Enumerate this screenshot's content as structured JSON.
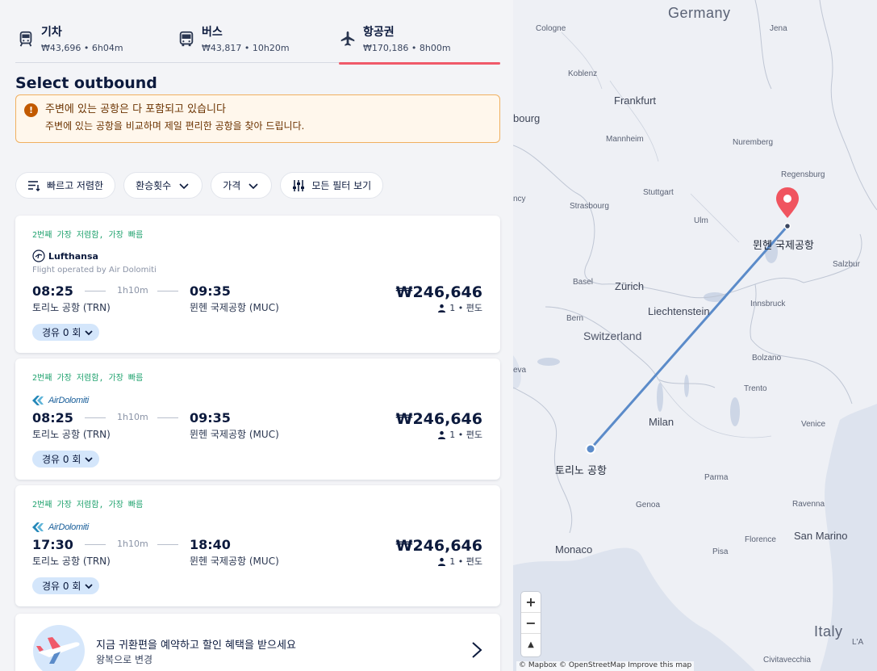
{
  "modes": [
    {
      "label": "기차",
      "summary": "₩43,696 • 6h04m",
      "icon": "train-icon",
      "active": false
    },
    {
      "label": "버스",
      "summary": "₩43,817 • 10h20m",
      "icon": "bus-icon",
      "active": false
    },
    {
      "label": "항공권",
      "summary": "₩170,186 • 8h00m",
      "icon": "plane-icon",
      "active": true
    }
  ],
  "page_title": "Select outbound",
  "notice": {
    "title": "주변에 있는 공항은 다 포함되고 있습니다",
    "desc": "주변에 있는 공항을 비교하며 제일 편리한 공항을 찾아 드립니다.",
    "icon": "warning-icon"
  },
  "filters": [
    {
      "label": "빠르고 저렴한",
      "icon": "sort-icon"
    },
    {
      "label": "환승횟수",
      "icon": "chevron-down-icon"
    },
    {
      "label": "가격",
      "icon": "chevron-down-icon"
    },
    {
      "label": "모든 필터 보기",
      "icon": "sliders-icon"
    }
  ],
  "results": [
    {
      "tag": "2번째 가장 저렴함, 가장 빠름",
      "airline": "Lufthansa",
      "operated": "Flight operated by Air Dolomiti",
      "depart": "08:25",
      "arrive": "09:35",
      "duration": "1h10m",
      "from": "토리노 공항 (TRN)",
      "to": "뮌헨 국제공항 (MUC)",
      "price": "₩246,646",
      "pax": "1 • 편도",
      "stops": "경유 0 회"
    },
    {
      "tag": "2번째 가장 저렴함, 가장 빠름",
      "airline": "AirDolomiti",
      "depart": "08:25",
      "arrive": "09:35",
      "duration": "1h10m",
      "from": "토리노 공항 (TRN)",
      "to": "뮌헨 국제공항 (MUC)",
      "price": "₩246,646",
      "pax": "1 • 편도",
      "stops": "경유 0 회"
    },
    {
      "tag": "2번째 가장 저렴함, 가장 빠름",
      "airline": "AirDolomiti",
      "depart": "17:30",
      "arrive": "18:40",
      "duration": "1h10m",
      "from": "토리노 공항 (TRN)",
      "to": "뮌헨 국제공항 (MUC)",
      "price": "₩246,646",
      "pax": "1 • 편도",
      "stops": "경유 0 회"
    }
  ],
  "promo": {
    "title": "지금 귀환편을 예약하고 할인 혜택을 받으세요",
    "sub": "왕복으로 변경"
  },
  "map": {
    "origin_label": "토리노 공항",
    "destination_label": "뮌헨 국제공항",
    "places": {
      "germany": "Germany",
      "cologne": "Cologne",
      "jena": "Jena",
      "koblenz": "Koblenz",
      "frankfurt": "Frankfurt",
      "bourg": "bourg",
      "mannheim": "Mannheim",
      "nuremberg": "Nuremberg",
      "regensburg": "Regensburg",
      "stuttgart": "Stuttgart",
      "ncy": "ncy",
      "strasbourg": "Strasbourg",
      "ulm": "Ulm",
      "salzburg": "Salzbur",
      "basel": "Basel",
      "zurich": "Zürich",
      "liechtenstein": "Liechtenstein",
      "innsbruck": "Innsbruck",
      "bern": "Bern",
      "switzerland": "Switzerland",
      "bolzano": "Bolzano",
      "trento": "Trento",
      "geneva": "eva",
      "milan": "Milan",
      "venice": "Venice",
      "parma": "Parma",
      "genoa": "Genoa",
      "ravenna": "Ravenna",
      "florence": "Florence",
      "san_marino": "San Marino",
      "monaco": "Monaco",
      "pisa": "Pisa",
      "italy": "Italy",
      "civitavecchia": "Civitavecchia",
      "la": "L'A"
    },
    "zoom_in": "+",
    "zoom_out": "−",
    "compass": "▲",
    "attribution": "© Mapbox © OpenStreetMap Improve this map",
    "route_color": "#5b8bc9",
    "pin_color": "#f0545f"
  }
}
